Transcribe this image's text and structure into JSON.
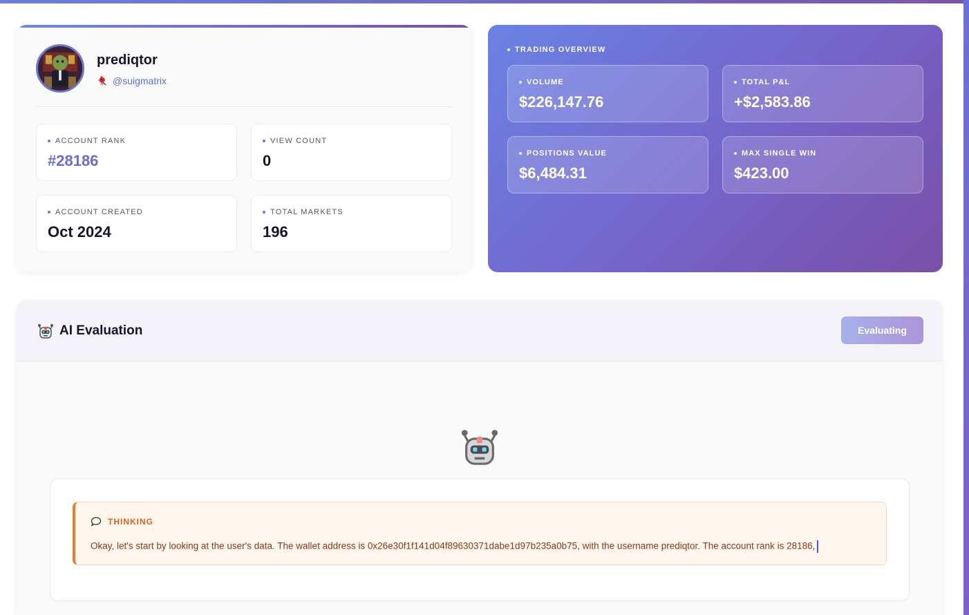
{
  "profile": {
    "username": "prediqtor",
    "handle": "@suigmatrix",
    "handle_icon": "cardinal-bird-icon",
    "stats": [
      {
        "label": "ACCOUNT RANK",
        "value": "#28186"
      },
      {
        "label": "VIEW COUNT",
        "value": "0"
      },
      {
        "label": "ACCOUNT CREATED",
        "value": "Oct 2024"
      },
      {
        "label": "TOTAL MARKETS",
        "value": "196"
      }
    ]
  },
  "trading": {
    "title": "TRADING OVERVIEW",
    "metrics": [
      {
        "label": "VOLUME",
        "value": "$226,147.76"
      },
      {
        "label": "TOTAL P&L",
        "value": "+$2,583.86"
      },
      {
        "label": "POSITIONS VALUE",
        "value": "$6,484.31"
      },
      {
        "label": "MAX SINGLE WIN",
        "value": "$423.00"
      }
    ]
  },
  "ai": {
    "title": "AI Evaluation",
    "button_label": "Evaluating",
    "thinking_label": "THINKING",
    "thinking_text": "Okay, let's start by looking at the user's data. The wallet address is 0x26e30f1f141d04f89630371dabe1d97b235a0b75, with the username prediqtor. The account rank is 28186,"
  },
  "colors": {
    "accent": "#6a6ad4",
    "gradient_start": "#6a82e4",
    "gradient_end": "#7a4fa8",
    "thinking_accent": "#ee7a2c"
  }
}
